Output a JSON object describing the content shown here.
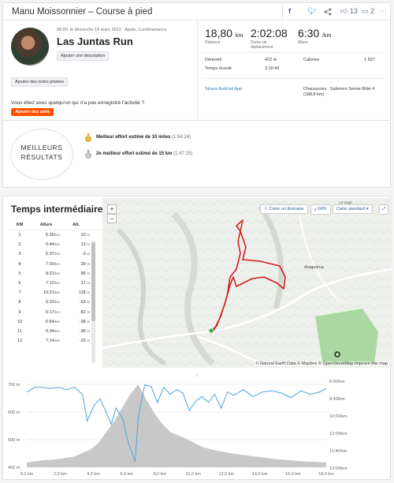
{
  "header": {
    "title": "Manu Moissonnier – Course à pied",
    "kudos_count": "13",
    "comments_count": "2"
  },
  "activity": {
    "date_location": "08:00, le dimanche 19 mars 2023 · Apulo, Cundinamarca",
    "title": "Las Juntas Run",
    "add_description": "Ajouter une description",
    "add_notes": "Ajouter des notes privées",
    "missing_question": "Vous étiez avec quelqu'un qui n'a pas enregistré l'activité ?",
    "add_friends": "Ajouter des amis"
  },
  "stats": {
    "distance_value": "18,80",
    "distance_unit": "km",
    "distance_label": "Distance",
    "moving_time_value": "2:02:08",
    "moving_time_label": "Durée de déplacement",
    "pace_value": "6:30",
    "pace_unit": "/km",
    "pace_label": "Allure",
    "elevation_label": "Dénivelé",
    "elevation_value": "422 m",
    "elapsed_label": "Temps écoulé",
    "elapsed_value": "2:10:43",
    "calories_label": "Calories",
    "calories_value": "1 927",
    "app": "Strava Android App",
    "shoes": "Chaussures : Salomon Sense Ride 4 (188,8 km)"
  },
  "best_efforts": {
    "label_line1": "MEILLEURS",
    "label_line2": "RÉSULTATS",
    "items": [
      {
        "text": "Meilleur effort estimé de 10 miles",
        "time": "(1:54:24)",
        "medal": "gold"
      },
      {
        "text": "2e meilleur effort estimé de 15 km",
        "time": "(1:47:25)",
        "medal": "silver"
      }
    ]
  },
  "splits": {
    "title": "Temps intermédiaires",
    "headers": [
      "KM",
      "Allure",
      "Alt."
    ],
    "pace_unit": "/km",
    "alt_unit": "m",
    "rows": [
      {
        "km": "1",
        "pace": "5:35",
        "alt": "10"
      },
      {
        "km": "2",
        "pace": "5:44",
        "alt": "13"
      },
      {
        "km": "3",
        "pace": "5:37",
        "alt": "-3"
      },
      {
        "km": "4",
        "pace": "7:20",
        "alt": "39"
      },
      {
        "km": "5",
        "pace": "8:21",
        "alt": "86"
      },
      {
        "km": "6",
        "pace": "7:12",
        "alt": "17"
      },
      {
        "km": "7",
        "pace": "10:21",
        "alt": "118"
      },
      {
        "km": "8",
        "pace": "5:22",
        "alt": "-63"
      },
      {
        "km": "9",
        "pace": "6:17",
        "alt": "-82"
      },
      {
        "km": "10",
        "pace": "6:54",
        "alt": "-38"
      },
      {
        "km": "11",
        "pace": "6:34",
        "alt": "-38"
      },
      {
        "km": "12",
        "pace": "7:14",
        "alt": "-23"
      }
    ]
  },
  "map": {
    "create_route": "Créer un itinéraire",
    "gpx": "GPX",
    "map_type": "Carte standard",
    "town_label": "Anapoima",
    "village_label": "La Vega",
    "attribution": "© Natural Earth Data © Mapbox © OpenStreetMap Improve this map",
    "zoom_in": "+",
    "zoom_out": "−"
  },
  "chart_data": {
    "type": "area",
    "xlabel": "",
    "x_ticks": [
      "0,0 km",
      "2,0 km",
      "4,0 km",
      "6,0 km",
      "8,0 km",
      "10,0 km",
      "12,0 km",
      "14,0 km",
      "16,0 km",
      "18,0 km"
    ],
    "left_axis_ticks": [
      "700 m",
      "600 m",
      "500 m",
      "400 m"
    ],
    "right_axis_ticks": [
      "6:00/km",
      "8:40/km",
      "10:00/km",
      "12:00/km",
      "11:40/km",
      "12:00/km"
    ],
    "xlim": [
      0,
      18.8
    ],
    "ylim_elevation": [
      400,
      720
    ],
    "colors": {
      "elevation_fill": "#c8c8c8",
      "pace_line": "#4aa4d8",
      "route": "#d1201a",
      "accent": "#fc5200"
    },
    "series": [
      {
        "name": "",
        "kind": "elevation_m",
        "x": [
          0,
          1,
          2,
          3,
          4,
          4.5,
          5,
          5.5,
          6,
          6.5,
          7,
          7.5,
          8,
          8.5,
          9,
          10,
          11,
          12,
          13,
          14,
          15,
          16,
          17,
          18,
          18.8
        ],
        "values": [
          418,
          425,
          430,
          440,
          465,
          490,
          530,
          570,
          620,
          670,
          705,
          650,
          600,
          560,
          530,
          505,
          475,
          460,
          450,
          442,
          435,
          428,
          423,
          420,
          418
        ]
      },
      {
        "name": "",
        "kind": "pace_min_per_km",
        "x": [
          0,
          0.5,
          1,
          1.5,
          2,
          2.5,
          3,
          3.5,
          3.8,
          4.2,
          4.6,
          5,
          5.3,
          5.6,
          6,
          6.4,
          6.8,
          7,
          7.4,
          7.8,
          8.2,
          8.6,
          9,
          9.4,
          9.8,
          10.2,
          10.6,
          11,
          11.4,
          11.8,
          12.2,
          12.6,
          13,
          13.6,
          14.2,
          14.8,
          15.4,
          16,
          16.6,
          17.2,
          17.8,
          18.4,
          18.8
        ],
        "values": [
          6.0,
          5.6,
          5.6,
          5.7,
          5.6,
          5.8,
          5.6,
          6.2,
          8.5,
          7.2,
          6.6,
          7.8,
          8.8,
          7.4,
          8.2,
          10.5,
          12.0,
          8.2,
          5.4,
          5.5,
          6.9,
          5.6,
          6.2,
          5.8,
          6.1,
          7.6,
          6.8,
          6.4,
          6.9,
          6.2,
          7.4,
          6.0,
          6.3,
          5.8,
          6.4,
          6.0,
          5.9,
          6.1,
          6.5,
          5.9,
          6.2,
          6.0,
          5.7
        ]
      }
    ]
  }
}
